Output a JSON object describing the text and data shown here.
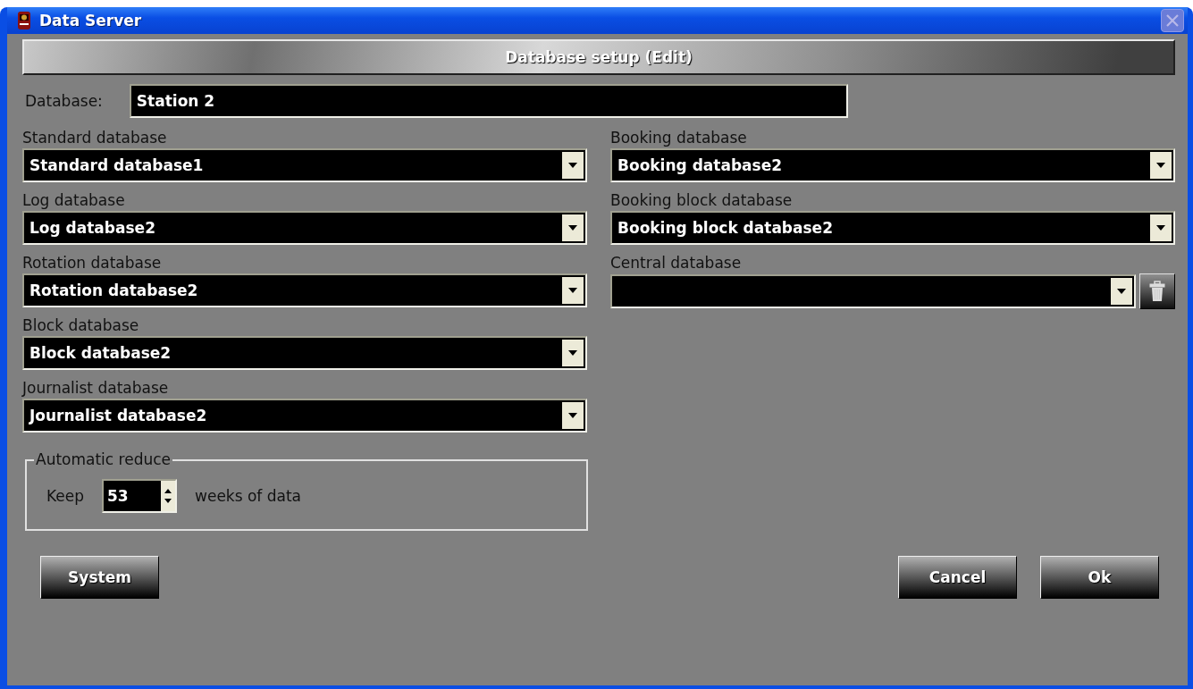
{
  "window": {
    "title": "Data Server"
  },
  "header": {
    "title": "Database setup (Edit)"
  },
  "database": {
    "label": "Database:",
    "value": "Station 2"
  },
  "left_column": [
    {
      "label": "Standard database",
      "value": "Standard database1",
      "kind": "select"
    },
    {
      "label": "Log database",
      "value": "Log database2",
      "kind": "select"
    },
    {
      "label": "Rotation database",
      "value": "Rotation database2",
      "kind": "select"
    },
    {
      "label": "Block database",
      "value": "Block database2",
      "kind": "select"
    },
    {
      "label": "Journalist database",
      "value": "Journalist database2",
      "kind": "select"
    }
  ],
  "right_column": [
    {
      "label": "Booking database",
      "value": "Booking database2",
      "kind": "select"
    },
    {
      "label": "Booking block database",
      "value": "Booking block database2",
      "kind": "select"
    },
    {
      "label": "Central database",
      "kind": "select-delete"
    }
  ],
  "automatic_reduce": {
    "title": "Automatic reduce",
    "prefix": "Keep",
    "value": "53",
    "suffix": "weeks of data"
  },
  "buttons": [
    {
      "label": "System",
      "kind": "left"
    },
    {
      "label": "Cancel",
      "kind": "right"
    },
    {
      "label": "Ok",
      "kind": "right"
    }
  ]
}
